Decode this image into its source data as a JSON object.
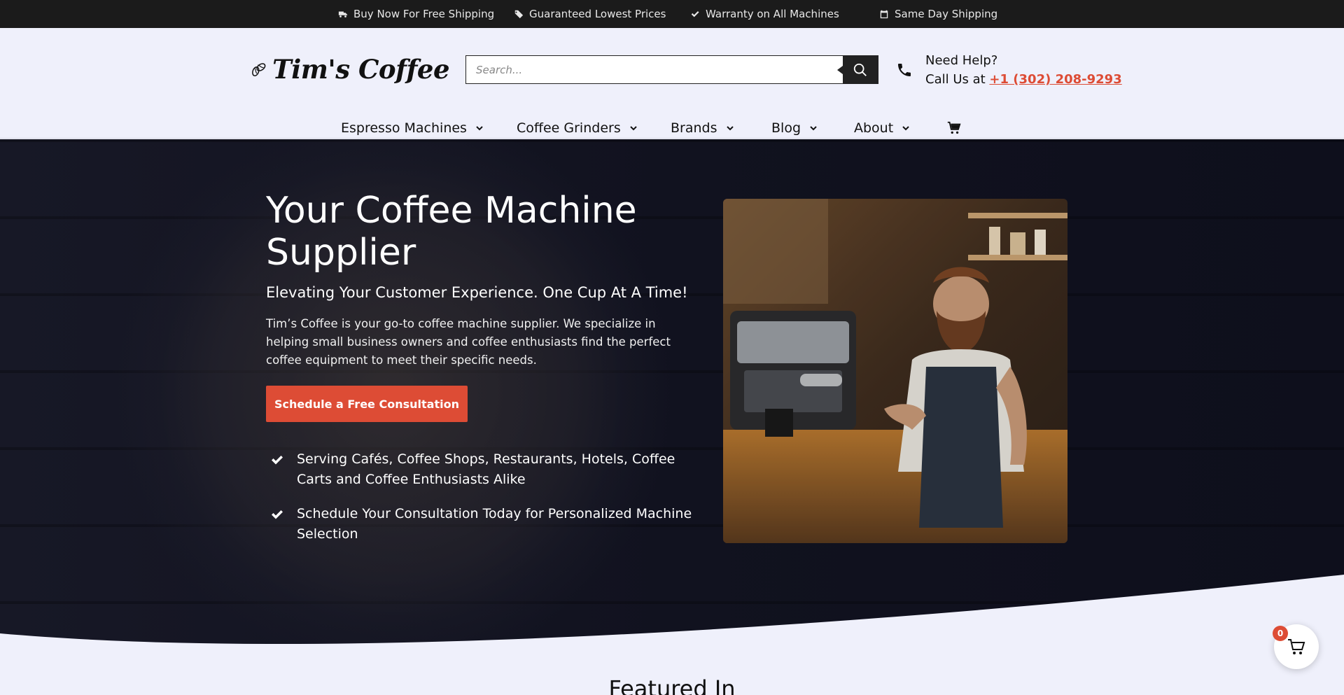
{
  "topbar": {
    "items": [
      {
        "label": "Buy Now For Free Shipping",
        "icon": "truck-icon"
      },
      {
        "label": "Guaranteed Lowest Prices",
        "icon": "tags-icon"
      },
      {
        "label": "Warranty on All Machines",
        "icon": "check-icon"
      },
      {
        "label": "Same Day Shipping",
        "icon": "calendar-icon"
      }
    ]
  },
  "header": {
    "logo_text": "Tim's Coffee",
    "search_placeholder": "Search...",
    "help_title": "Need Help?",
    "help_call_prefix": "Call Us at",
    "phone": "+1 (302) 208-9293"
  },
  "nav": {
    "items": [
      {
        "label": "Espresso Machines"
      },
      {
        "label": "Coffee Grinders"
      },
      {
        "label": "Brands"
      },
      {
        "label": "Blog"
      },
      {
        "label": "About"
      }
    ]
  },
  "hero": {
    "title": "Your Coffee Machine Supplier",
    "subtitle": "Elevating Your Customer Experience. One Cup At A Time!",
    "description": "Tim’s Coffee is your go-to coffee machine supplier. We specialize in helping small business owners and coffee enthusiasts find the perfect coffee equipment to meet their specific needs.",
    "cta_label": "Schedule a Free Consultation",
    "bullets": [
      "Serving Cafés, Coffee Shops, Restaurants, Hotels, Coffee Carts and Coffee Enthusiasts Alike",
      "Schedule Your Consultation Today for Personalized Machine Selection"
    ]
  },
  "featured": {
    "heading": "Featured In"
  },
  "cart": {
    "count": "0"
  },
  "colors": {
    "accent": "#dd4c35",
    "topbar_bg": "#1b1b1b",
    "page_bg": "#eff0fb",
    "hero_bg": "#0d0e1c"
  }
}
